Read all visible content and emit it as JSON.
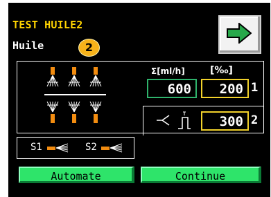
{
  "header": {
    "title": "TEST HUILE2",
    "subtitle": "Huile",
    "step_badge": "2"
  },
  "columns": {
    "flow_header": "Σ[ml/h]",
    "permil_header": "[‰]"
  },
  "rows": [
    {
      "flow_value": "600",
      "permil_value": "200",
      "index": "1"
    },
    {
      "permil_value": "300",
      "index": "2"
    }
  ],
  "sensors": {
    "s1_label": "S1",
    "s2_label": "S2"
  },
  "buttons": {
    "automate": "Automate",
    "continue": "Continue"
  },
  "colors": {
    "title_yellow": "#ffd400",
    "badge_orange": "#f6b21a",
    "button_green": "#2ee46a",
    "nozzle_orange": "#f28c10",
    "field_green_border": "#2fb36c",
    "field_yellow_border": "#f2d22b"
  },
  "icons": {
    "next": "arrow-right-icon",
    "nozzles": "spray-nozzle-icon",
    "valve": "valve-icon",
    "pulse": "pulse-icon"
  }
}
